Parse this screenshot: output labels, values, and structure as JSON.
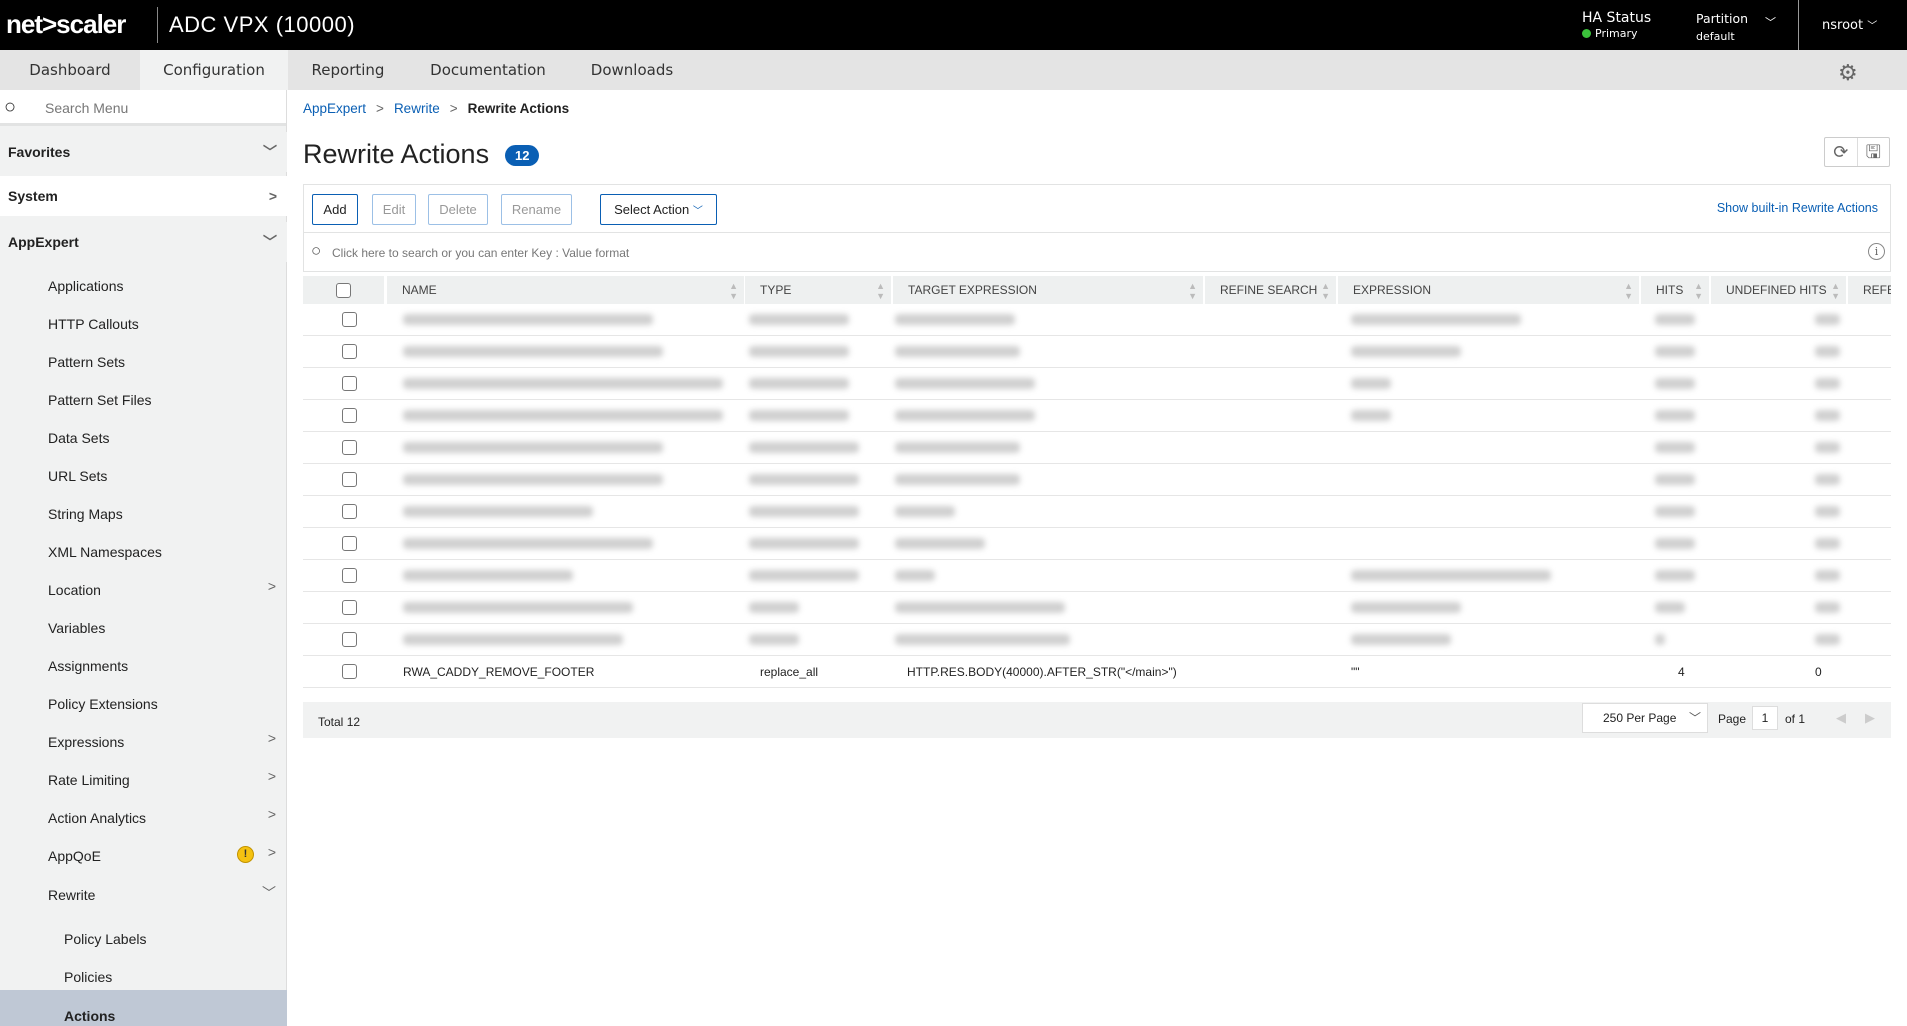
{
  "header": {
    "logo": "net>scaler",
    "product": "ADC VPX (10000)",
    "ha_label": "HA Status",
    "ha_value": "Primary",
    "partition_label": "Partition",
    "partition_value": "default",
    "user": "nsroot",
    "ha_color": "#3bc23b"
  },
  "tabs": [
    {
      "label": "Dashboard"
    },
    {
      "label": "Configuration",
      "active": true
    },
    {
      "label": "Reporting"
    },
    {
      "label": "Documentation"
    },
    {
      "label": "Downloads"
    }
  ],
  "sidebar": {
    "search_placeholder": "Search Menu",
    "groups": [
      {
        "label": "Favorites"
      },
      {
        "label": "System"
      },
      {
        "label": "AppExpert"
      }
    ],
    "items": [
      {
        "label": "Applications"
      },
      {
        "label": "HTTP Callouts"
      },
      {
        "label": "Pattern Sets"
      },
      {
        "label": "Pattern Set Files"
      },
      {
        "label": "Data Sets"
      },
      {
        "label": "URL Sets"
      },
      {
        "label": "String Maps"
      },
      {
        "label": "XML Namespaces"
      },
      {
        "label": "Location"
      },
      {
        "label": "Variables"
      },
      {
        "label": "Assignments"
      },
      {
        "label": "Policy Extensions"
      },
      {
        "label": "Expressions"
      },
      {
        "label": "Rate Limiting"
      },
      {
        "label": "Action Analytics"
      },
      {
        "label": "AppQoE"
      },
      {
        "label": "Rewrite"
      }
    ],
    "sub_items": [
      {
        "label": "Policy Labels"
      },
      {
        "label": "Policies"
      },
      {
        "label": "Actions",
        "active": true
      }
    ]
  },
  "breadcrumb": [
    "AppExpert",
    "Rewrite",
    "Rewrite Actions"
  ],
  "page": {
    "title": "Rewrite Actions",
    "count": "12"
  },
  "toolbar": {
    "add": "Add",
    "edit": "Edit",
    "delete": "Delete",
    "rename": "Rename",
    "select_action": "Select Action",
    "show_builtin": "Show built-in Rewrite Actions"
  },
  "search": {
    "placeholder": "Click here to search or you can enter Key : Value format"
  },
  "table": {
    "columns": [
      "NAME",
      "TYPE",
      "TARGET EXPRESSION",
      "REFINE SEARCH",
      "EXPRESSION",
      "HITS",
      "UNDEFINED HITS",
      "REFER"
    ],
    "visible_row": {
      "name": "RWA_CADDY_REMOVE_FOOTER",
      "type": "replace_all",
      "target": "HTTP.RES.BODY(40000).AFTER_STR(\"</main>\")",
      "expression": "\"\"",
      "hits": "4",
      "undefined_hits": "0"
    }
  },
  "footer": {
    "total_label": "Total",
    "total": "12",
    "per_page": "250 Per Page",
    "page_label": "Page",
    "page": "1",
    "of": "of 1"
  }
}
